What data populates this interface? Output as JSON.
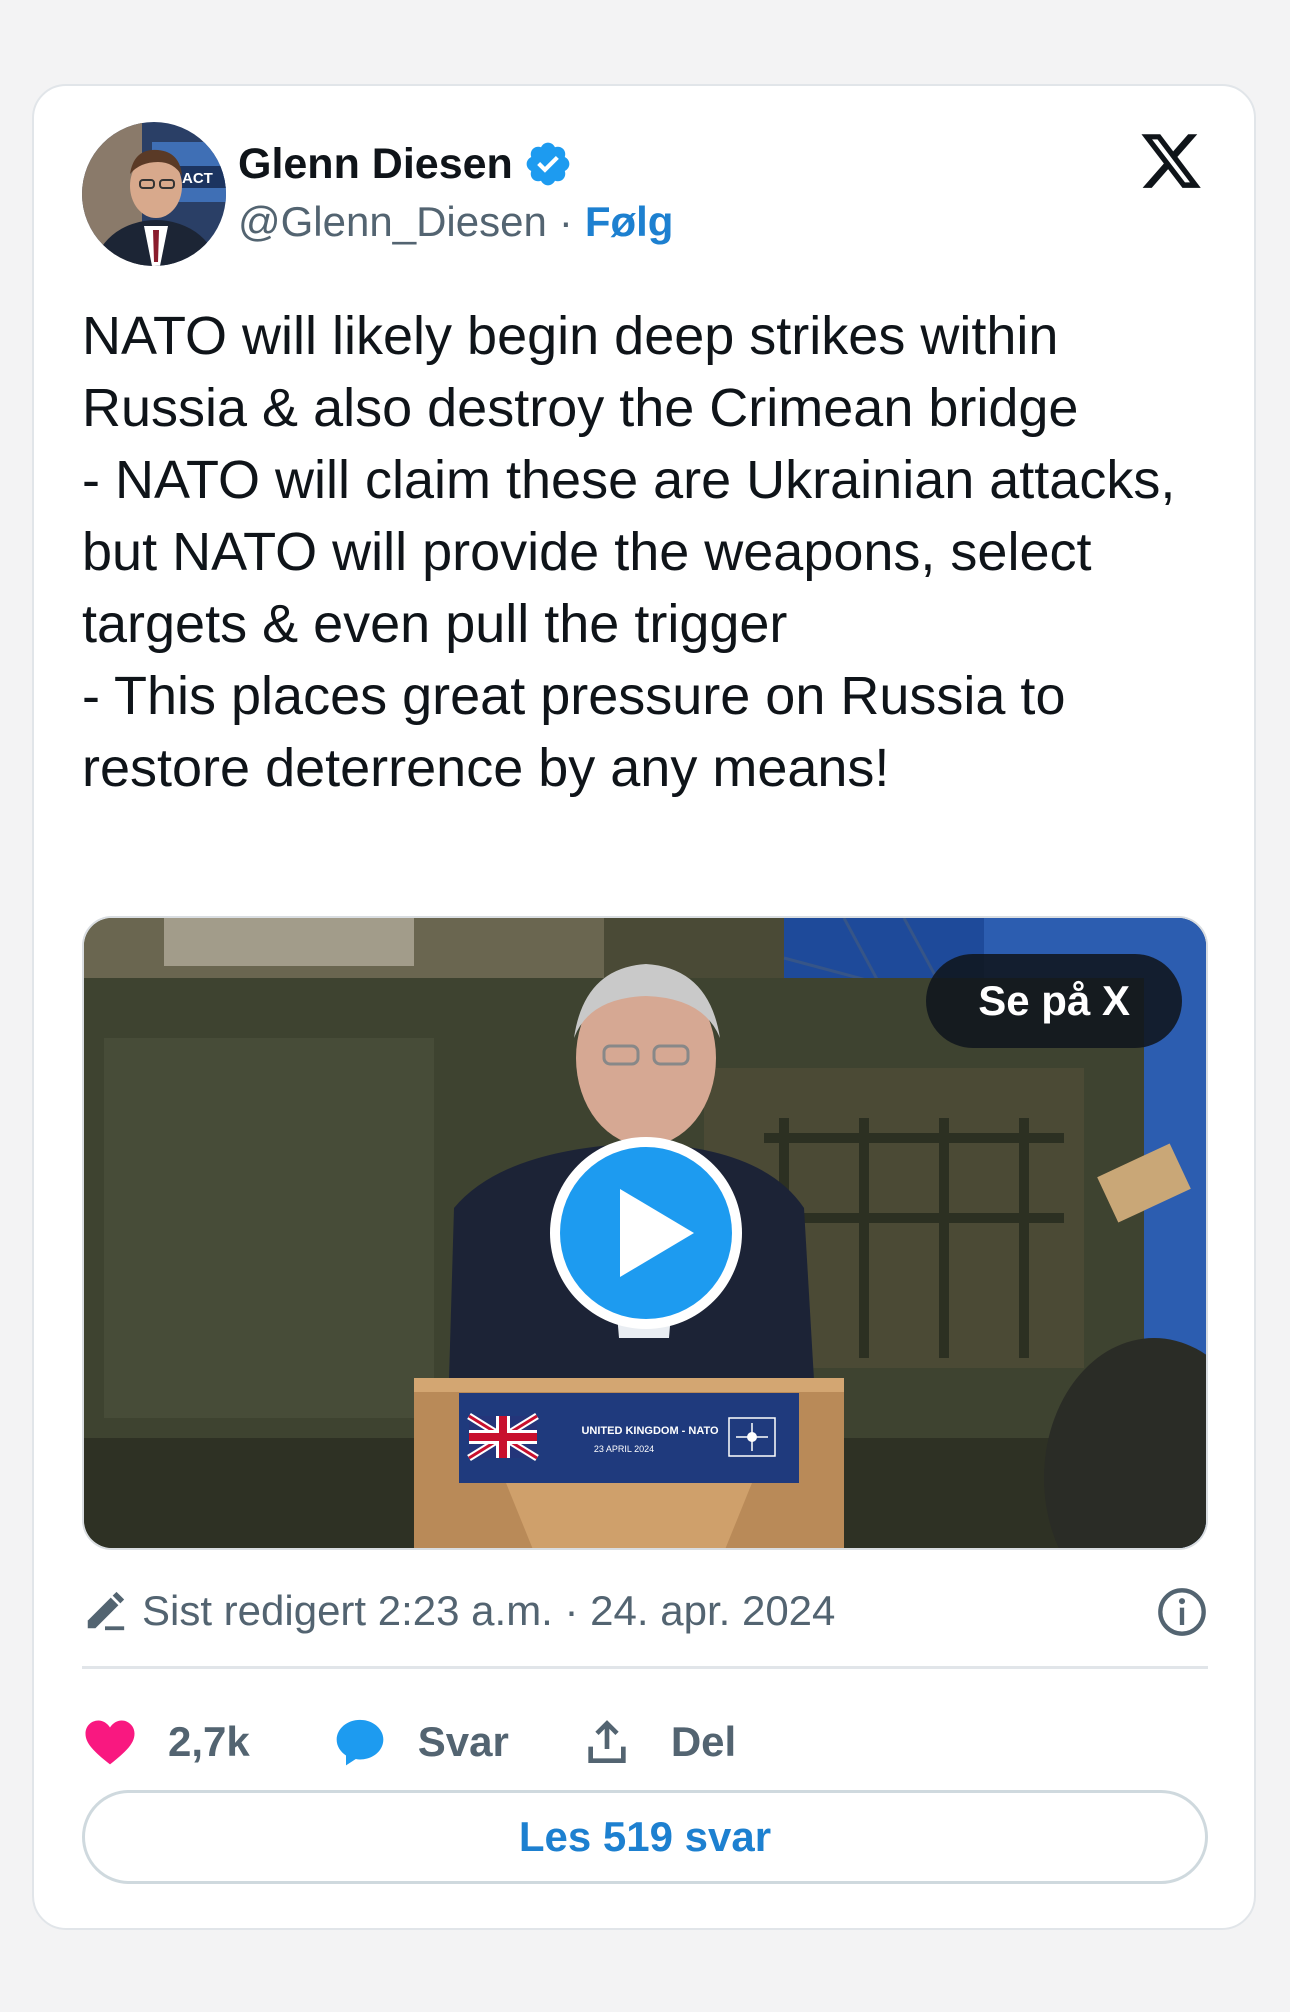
{
  "author": {
    "name": "Glenn Diesen",
    "handle": "@Glenn_Diesen",
    "separator": "·",
    "follow_label": "Følg",
    "verified": true,
    "avatar_badge_text": "ACT"
  },
  "tweet": {
    "text": "NATO will likely begin deep strikes within Russia & also destroy the Crimean bridge\n- NATO will claim these are Ukrainian attacks, but NATO will provide the weapons, select targets & even pull the trigger\n- This places great pressure on Russia to restore deterrence by any means!"
  },
  "media": {
    "watch_label": "Se på X",
    "podium_sign_line1": "UNITED KINGDOM - NATO",
    "podium_sign_line2": "23 APRIL 2024"
  },
  "meta": {
    "edited_text": "Sist redigert 2:23 a.m. · 24. apr. 2024"
  },
  "actions": {
    "likes": "2,7k",
    "reply_label": "Svar",
    "share_label": "Del"
  },
  "replies_button": "Les 519 svar",
  "colors": {
    "accent": "#1d9bf0",
    "link": "#1d80d0",
    "like": "#f91880",
    "text": "#0f1419",
    "secondary": "#536471"
  },
  "icons": [
    "verified-badge-icon",
    "x-logo-icon",
    "play-icon",
    "pencil-icon",
    "info-icon",
    "heart-icon",
    "reply-bubble-icon",
    "share-icon"
  ]
}
